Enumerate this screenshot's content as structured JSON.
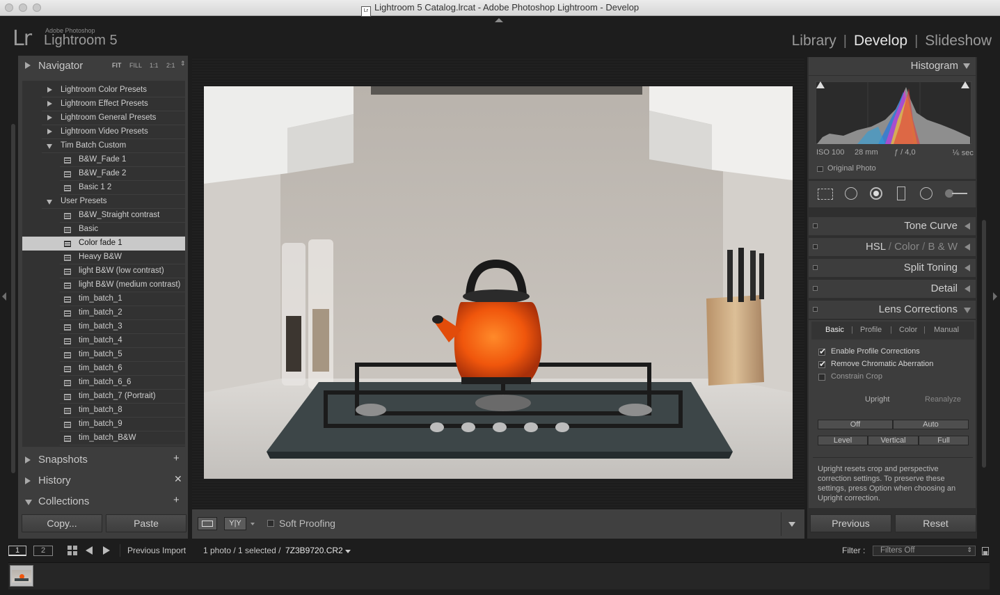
{
  "window": {
    "title": "Lightroom 5 Catalog.lrcat - Adobe Photoshop Lightroom - Develop"
  },
  "identity": {
    "mark": "Lr",
    "vendor": "Adobe Photoshop",
    "product": "Lightroom 5"
  },
  "modules": [
    {
      "label": "Library"
    },
    {
      "label": "Develop",
      "active": true
    },
    {
      "label": "Slideshow"
    }
  ],
  "navigator": {
    "title": "Navigator",
    "zoom": [
      "FIT",
      "FILL",
      "1:1",
      "2:1"
    ]
  },
  "presets": [
    {
      "label": "Lightroom Color Presets",
      "type": "folder",
      "open": false
    },
    {
      "label": "Lightroom Effect Presets",
      "type": "folder",
      "open": false
    },
    {
      "label": "Lightroom General Presets",
      "type": "folder",
      "open": false
    },
    {
      "label": "Lightroom Video Presets",
      "type": "folder",
      "open": false
    },
    {
      "label": "Tim Batch Custom",
      "type": "folder",
      "open": true
    },
    {
      "label": "B&W_Fade 1",
      "type": "preset"
    },
    {
      "label": "B&W_Fade 2",
      "type": "preset"
    },
    {
      "label": "Basic 1 2",
      "type": "preset"
    },
    {
      "label": "User Presets",
      "type": "folder",
      "open": true
    },
    {
      "label": "B&W_Straight contrast",
      "type": "preset"
    },
    {
      "label": "Basic",
      "type": "preset"
    },
    {
      "label": "Color fade 1",
      "type": "preset",
      "selected": true
    },
    {
      "label": "Heavy B&W",
      "type": "preset"
    },
    {
      "label": "light B&W (low contrast)",
      "type": "preset"
    },
    {
      "label": "light B&W (medium contrast)",
      "type": "preset"
    },
    {
      "label": "tim_batch_1",
      "type": "preset"
    },
    {
      "label": "tim_batch_2",
      "type": "preset"
    },
    {
      "label": "tim_batch_3",
      "type": "preset"
    },
    {
      "label": "tim_batch_4",
      "type": "preset"
    },
    {
      "label": "tim_batch_5",
      "type": "preset"
    },
    {
      "label": "tim_batch_6",
      "type": "preset"
    },
    {
      "label": "tim_batch_6_6",
      "type": "preset"
    },
    {
      "label": "tim_batch_7 (Portrait)",
      "type": "preset"
    },
    {
      "label": "tim_batch_8",
      "type": "preset"
    },
    {
      "label": "tim_batch_9",
      "type": "preset"
    },
    {
      "label": "tim_batch_B&W",
      "type": "preset"
    }
  ],
  "left_sections": {
    "snapshots": "Snapshots",
    "history": "History",
    "collections": "Collections"
  },
  "left_buttons": {
    "copy": "Copy...",
    "paste": "Paste"
  },
  "toolbar": {
    "soft_proofing": "Soft Proofing",
    "yy": "Y|Y"
  },
  "histogram": {
    "title": "Histogram",
    "iso": "ISO 100",
    "focal": "28 mm",
    "aperture": "ƒ / 4,0",
    "shutter": "⅙ sec",
    "original_photo": "Original Photo"
  },
  "right_sections": {
    "tone_curve": "Tone Curve",
    "hsl": "HSL",
    "color": "Color",
    "bw": "B & W",
    "split_toning": "Split Toning",
    "detail": "Detail",
    "lens_corrections": "Lens Corrections"
  },
  "lens": {
    "tabs": [
      "Basic",
      "Profile",
      "Color",
      "Manual"
    ],
    "enable_profile": "Enable Profile Corrections",
    "remove_ca": "Remove Chromatic Aberration",
    "constrain_crop": "Constrain Crop",
    "upright": "Upright",
    "reanalyze": "Reanalyze",
    "off": "Off",
    "auto": "Auto",
    "level": "Level",
    "vertical": "Vertical",
    "full": "Full",
    "note": "Upright resets crop and perspective correction settings. To preserve these settings, press Option when choosing an Upright correction."
  },
  "right_buttons": {
    "previous": "Previous",
    "reset": "Reset"
  },
  "filmstrip": {
    "view1": "1",
    "view2": "2",
    "source": "Previous Import",
    "count": "1 photo / 1 selected /",
    "filename": "7Z3B9720.CR2",
    "filter_label": "Filter :",
    "filter_value": "Filters Off"
  }
}
